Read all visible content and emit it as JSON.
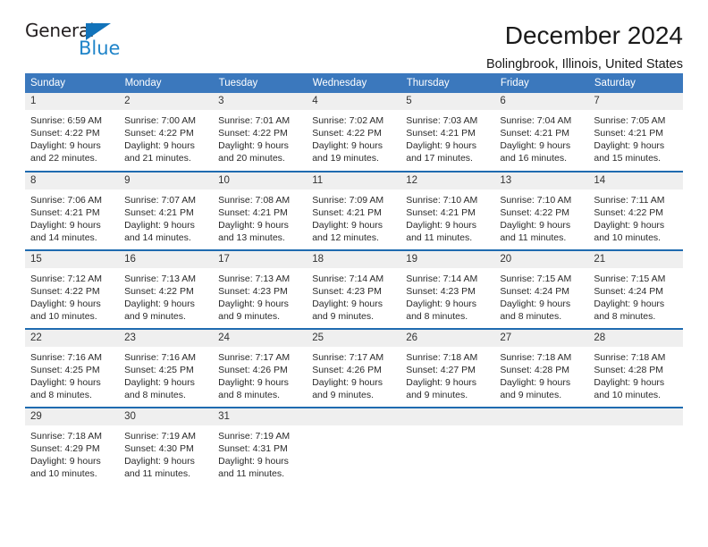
{
  "brand": {
    "name_dark": "General",
    "name_blue": "Blue",
    "triangle_color": "#1273ba",
    "blue_color": "#1f84c9"
  },
  "header": {
    "title": "December 2024",
    "subtitle": "Bolingbrook, Illinois, United States",
    "header_bg": "#3b78bd",
    "row_divider": "#1f6bb0",
    "daynum_bg": "#efefef"
  },
  "calendar": {
    "weekday_headers": [
      "Sunday",
      "Monday",
      "Tuesday",
      "Wednesday",
      "Thursday",
      "Friday",
      "Saturday"
    ],
    "weeks": [
      [
        {
          "day": "1",
          "sunrise": "Sunrise: 6:59 AM",
          "sunset": "Sunset: 4:22 PM",
          "daylight1": "Daylight: 9 hours",
          "daylight2": "and 22 minutes."
        },
        {
          "day": "2",
          "sunrise": "Sunrise: 7:00 AM",
          "sunset": "Sunset: 4:22 PM",
          "daylight1": "Daylight: 9 hours",
          "daylight2": "and 21 minutes."
        },
        {
          "day": "3",
          "sunrise": "Sunrise: 7:01 AM",
          "sunset": "Sunset: 4:22 PM",
          "daylight1": "Daylight: 9 hours",
          "daylight2": "and 20 minutes."
        },
        {
          "day": "4",
          "sunrise": "Sunrise: 7:02 AM",
          "sunset": "Sunset: 4:22 PM",
          "daylight1": "Daylight: 9 hours",
          "daylight2": "and 19 minutes."
        },
        {
          "day": "5",
          "sunrise": "Sunrise: 7:03 AM",
          "sunset": "Sunset: 4:21 PM",
          "daylight1": "Daylight: 9 hours",
          "daylight2": "and 17 minutes."
        },
        {
          "day": "6",
          "sunrise": "Sunrise: 7:04 AM",
          "sunset": "Sunset: 4:21 PM",
          "daylight1": "Daylight: 9 hours",
          "daylight2": "and 16 minutes."
        },
        {
          "day": "7",
          "sunrise": "Sunrise: 7:05 AM",
          "sunset": "Sunset: 4:21 PM",
          "daylight1": "Daylight: 9 hours",
          "daylight2": "and 15 minutes."
        }
      ],
      [
        {
          "day": "8",
          "sunrise": "Sunrise: 7:06 AM",
          "sunset": "Sunset: 4:21 PM",
          "daylight1": "Daylight: 9 hours",
          "daylight2": "and 14 minutes."
        },
        {
          "day": "9",
          "sunrise": "Sunrise: 7:07 AM",
          "sunset": "Sunset: 4:21 PM",
          "daylight1": "Daylight: 9 hours",
          "daylight2": "and 14 minutes."
        },
        {
          "day": "10",
          "sunrise": "Sunrise: 7:08 AM",
          "sunset": "Sunset: 4:21 PM",
          "daylight1": "Daylight: 9 hours",
          "daylight2": "and 13 minutes."
        },
        {
          "day": "11",
          "sunrise": "Sunrise: 7:09 AM",
          "sunset": "Sunset: 4:21 PM",
          "daylight1": "Daylight: 9 hours",
          "daylight2": "and 12 minutes."
        },
        {
          "day": "12",
          "sunrise": "Sunrise: 7:10 AM",
          "sunset": "Sunset: 4:21 PM",
          "daylight1": "Daylight: 9 hours",
          "daylight2": "and 11 minutes."
        },
        {
          "day": "13",
          "sunrise": "Sunrise: 7:10 AM",
          "sunset": "Sunset: 4:22 PM",
          "daylight1": "Daylight: 9 hours",
          "daylight2": "and 11 minutes."
        },
        {
          "day": "14",
          "sunrise": "Sunrise: 7:11 AM",
          "sunset": "Sunset: 4:22 PM",
          "daylight1": "Daylight: 9 hours",
          "daylight2": "and 10 minutes."
        }
      ],
      [
        {
          "day": "15",
          "sunrise": "Sunrise: 7:12 AM",
          "sunset": "Sunset: 4:22 PM",
          "daylight1": "Daylight: 9 hours",
          "daylight2": "and 10 minutes."
        },
        {
          "day": "16",
          "sunrise": "Sunrise: 7:13 AM",
          "sunset": "Sunset: 4:22 PM",
          "daylight1": "Daylight: 9 hours",
          "daylight2": "and 9 minutes."
        },
        {
          "day": "17",
          "sunrise": "Sunrise: 7:13 AM",
          "sunset": "Sunset: 4:23 PM",
          "daylight1": "Daylight: 9 hours",
          "daylight2": "and 9 minutes."
        },
        {
          "day": "18",
          "sunrise": "Sunrise: 7:14 AM",
          "sunset": "Sunset: 4:23 PM",
          "daylight1": "Daylight: 9 hours",
          "daylight2": "and 9 minutes."
        },
        {
          "day": "19",
          "sunrise": "Sunrise: 7:14 AM",
          "sunset": "Sunset: 4:23 PM",
          "daylight1": "Daylight: 9 hours",
          "daylight2": "and 8 minutes."
        },
        {
          "day": "20",
          "sunrise": "Sunrise: 7:15 AM",
          "sunset": "Sunset: 4:24 PM",
          "daylight1": "Daylight: 9 hours",
          "daylight2": "and 8 minutes."
        },
        {
          "day": "21",
          "sunrise": "Sunrise: 7:15 AM",
          "sunset": "Sunset: 4:24 PM",
          "daylight1": "Daylight: 9 hours",
          "daylight2": "and 8 minutes."
        }
      ],
      [
        {
          "day": "22",
          "sunrise": "Sunrise: 7:16 AM",
          "sunset": "Sunset: 4:25 PM",
          "daylight1": "Daylight: 9 hours",
          "daylight2": "and 8 minutes."
        },
        {
          "day": "23",
          "sunrise": "Sunrise: 7:16 AM",
          "sunset": "Sunset: 4:25 PM",
          "daylight1": "Daylight: 9 hours",
          "daylight2": "and 8 minutes."
        },
        {
          "day": "24",
          "sunrise": "Sunrise: 7:17 AM",
          "sunset": "Sunset: 4:26 PM",
          "daylight1": "Daylight: 9 hours",
          "daylight2": "and 8 minutes."
        },
        {
          "day": "25",
          "sunrise": "Sunrise: 7:17 AM",
          "sunset": "Sunset: 4:26 PM",
          "daylight1": "Daylight: 9 hours",
          "daylight2": "and 9 minutes."
        },
        {
          "day": "26",
          "sunrise": "Sunrise: 7:18 AM",
          "sunset": "Sunset: 4:27 PM",
          "daylight1": "Daylight: 9 hours",
          "daylight2": "and 9 minutes."
        },
        {
          "day": "27",
          "sunrise": "Sunrise: 7:18 AM",
          "sunset": "Sunset: 4:28 PM",
          "daylight1": "Daylight: 9 hours",
          "daylight2": "and 9 minutes."
        },
        {
          "day": "28",
          "sunrise": "Sunrise: 7:18 AM",
          "sunset": "Sunset: 4:28 PM",
          "daylight1": "Daylight: 9 hours",
          "daylight2": "and 10 minutes."
        }
      ],
      [
        {
          "day": "29",
          "sunrise": "Sunrise: 7:18 AM",
          "sunset": "Sunset: 4:29 PM",
          "daylight1": "Daylight: 9 hours",
          "daylight2": "and 10 minutes."
        },
        {
          "day": "30",
          "sunrise": "Sunrise: 7:19 AM",
          "sunset": "Sunset: 4:30 PM",
          "daylight1": "Daylight: 9 hours",
          "daylight2": "and 11 minutes."
        },
        {
          "day": "31",
          "sunrise": "Sunrise: 7:19 AM",
          "sunset": "Sunset: 4:31 PM",
          "daylight1": "Daylight: 9 hours",
          "daylight2": "and 11 minutes."
        },
        {
          "day": "",
          "sunrise": "",
          "sunset": "",
          "daylight1": "",
          "daylight2": ""
        },
        {
          "day": "",
          "sunrise": "",
          "sunset": "",
          "daylight1": "",
          "daylight2": ""
        },
        {
          "day": "",
          "sunrise": "",
          "sunset": "",
          "daylight1": "",
          "daylight2": ""
        },
        {
          "day": "",
          "sunrise": "",
          "sunset": "",
          "daylight1": "",
          "daylight2": ""
        }
      ]
    ]
  }
}
